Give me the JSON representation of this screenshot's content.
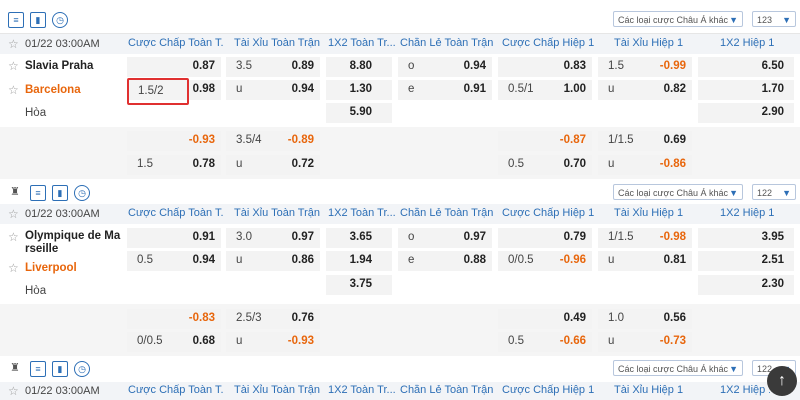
{
  "toolbar": {
    "market_select": "Các loại cược Châu Á khác",
    "counts": [
      "123",
      "122",
      "122"
    ]
  },
  "headers": [
    "Cược Chấp Toàn T...",
    "Tài Xỉu Toàn Trận",
    "1X2 Toàn Tr...",
    "Chẵn Lẻ Toàn Trận",
    "Cược Chấp Hiệp 1",
    "Tài Xỉu Hiệp 1",
    "1X2 Hiệp 1"
  ],
  "draw_label": "Hòa",
  "matches": [
    {
      "time": "01/22 03:00AM",
      "home": "Slavia Praha",
      "away": "Barcelona",
      "hcap_line": "1.5/2",
      "hcap_home": "0.87",
      "hcap_away": "0.98",
      "ou_line": "3.5",
      "ou_over": "0.89",
      "ou_u": "u",
      "ou_under": "0.94",
      "x12_home": "8.80",
      "x12_away": "1.30",
      "x12_draw": "5.90",
      "oe_o": "o",
      "oe_o_val": "0.94",
      "oe_e": "e",
      "oe_e_val": "0.91",
      "h1_hcap_home": "0.83",
      "h1_hcap_line": "0.5/1",
      "h1_hcap_away": "1.00",
      "h1_ou_line": "1.5",
      "h1_ou_over": "-0.99",
      "h1_ou_u": "u",
      "h1_ou_under": "0.82",
      "h1_x12_home": "6.50",
      "h1_x12_away": "1.70",
      "h1_x12_draw": "2.90",
      "ext": {
        "hcap_top": "-0.93",
        "hcap_line": "1.5",
        "hcap_bottom": "0.78",
        "ou_line": "3.5/4",
        "ou_top": "-0.89",
        "ou_u": "u",
        "ou_bottom": "0.72",
        "h1_hcap_top": "-0.87",
        "h1_hcap_line": "0.5",
        "h1_hcap_bottom": "0.70",
        "h1_ou_line": "1/1.5",
        "h1_ou_top": "0.69",
        "h1_ou_u": "u",
        "h1_ou_bottom": "-0.86"
      }
    },
    {
      "time": "01/22 03:00AM",
      "home_line1": "Olympique de Ma",
      "home_line2": "rseille",
      "away": "Liverpool",
      "hcap_home": "0.91",
      "hcap_line": "0.5",
      "hcap_away": "0.94",
      "ou_line": "3.0",
      "ou_over": "0.97",
      "ou_u": "u",
      "ou_under": "0.86",
      "x12_home": "3.65",
      "x12_away": "1.94",
      "x12_draw": "3.75",
      "oe_o": "o",
      "oe_o_val": "0.97",
      "oe_e": "e",
      "oe_e_val": "0.88",
      "h1_hcap_home": "0.79",
      "h1_hcap_line": "0/0.5",
      "h1_hcap_away": "-0.96",
      "h1_ou_line": "1/1.5",
      "h1_ou_over": "-0.98",
      "h1_ou_u": "u",
      "h1_ou_under": "0.81",
      "h1_x12_home": "3.95",
      "h1_x12_away": "2.51",
      "h1_x12_draw": "2.30",
      "ext": {
        "hcap_top": "-0.83",
        "hcap_line": "0/0.5",
        "hcap_bottom": "0.68",
        "ou_line": "2.5/3",
        "ou_top": "0.76",
        "ou_u": "u",
        "ou_bottom": "-0.93",
        "h1_hcap_top": "0.49",
        "h1_hcap_line": "0.5",
        "h1_hcap_bottom": "-0.66",
        "h1_ou_line": "1.0",
        "h1_ou_top": "0.56",
        "h1_ou_u": "u",
        "h1_ou_bottom": "-0.73"
      }
    },
    {
      "time": "01/22 03:00AM"
    }
  ],
  "icons": [
    "bell-icon",
    "list-icon",
    "chart-icon",
    "clock-icon",
    "star-icon",
    "scroll-top-icon"
  ],
  "colors": {
    "accent": "#2d6fb6",
    "negative": "#e8660c",
    "highlight": "#e03030"
  }
}
